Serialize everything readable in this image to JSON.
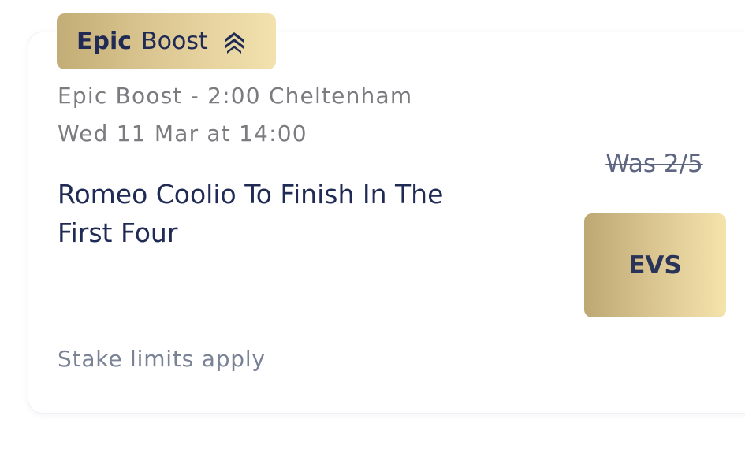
{
  "badge": {
    "strong": "Epic",
    "light": "Boost",
    "icon": "double-chevron-up-icon"
  },
  "event": {
    "title": "Epic Boost - 2:00 Cheltenham",
    "datetime": "Wed 11 Mar at 14:00"
  },
  "selection": {
    "name": "Romeo Coolio To Finish In The First Four"
  },
  "odds": {
    "was": "Was 2/5",
    "boosted": "EVS"
  },
  "footer": {
    "note": "Stake limits apply"
  },
  "colors": {
    "navy": "#1f2a55",
    "gold_start": "#bda873",
    "gold_end": "#f5e3ac",
    "subtitle_gray": "#7c7c80"
  }
}
